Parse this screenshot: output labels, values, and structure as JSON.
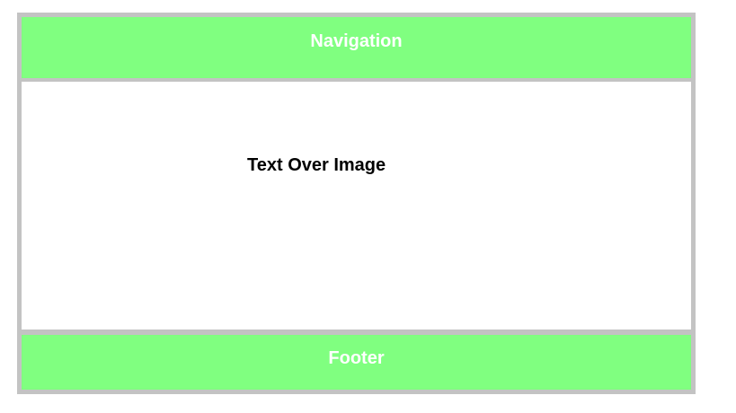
{
  "navigation": {
    "label": "Navigation"
  },
  "main": {
    "overlay_text": "Text Over Image"
  },
  "footer": {
    "label": "Footer"
  },
  "colors": {
    "bar_green": "#80ff80",
    "border_gray": "#c3c3c3",
    "bar_text": "#ffffff",
    "content_background": "#ffffff",
    "overlay_text": "#000000"
  }
}
